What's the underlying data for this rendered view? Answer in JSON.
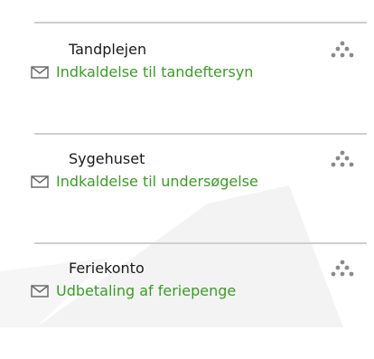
{
  "messages": [
    {
      "sender": "Tandplejen",
      "subject": "Indkaldelse til tandeftersyn",
      "icon": "envelope-icon",
      "menu_icon": "dots-menu-icon"
    },
    {
      "sender": "Sygehuset",
      "subject": "Indkaldelse til undersøgelse",
      "icon": "envelope-icon",
      "menu_icon": "dots-menu-icon"
    },
    {
      "sender": "Feriekonto",
      "subject": "Udbetaling af feriepenge",
      "icon": "envelope-icon",
      "menu_icon": "dots-menu-icon"
    }
  ],
  "colors": {
    "subject_text": "#3d9a2a",
    "sender_text": "#1a1a1a",
    "divider": "#cfcfcf",
    "icon": "#8a8a8a",
    "watermark": "#f2f2f2"
  }
}
